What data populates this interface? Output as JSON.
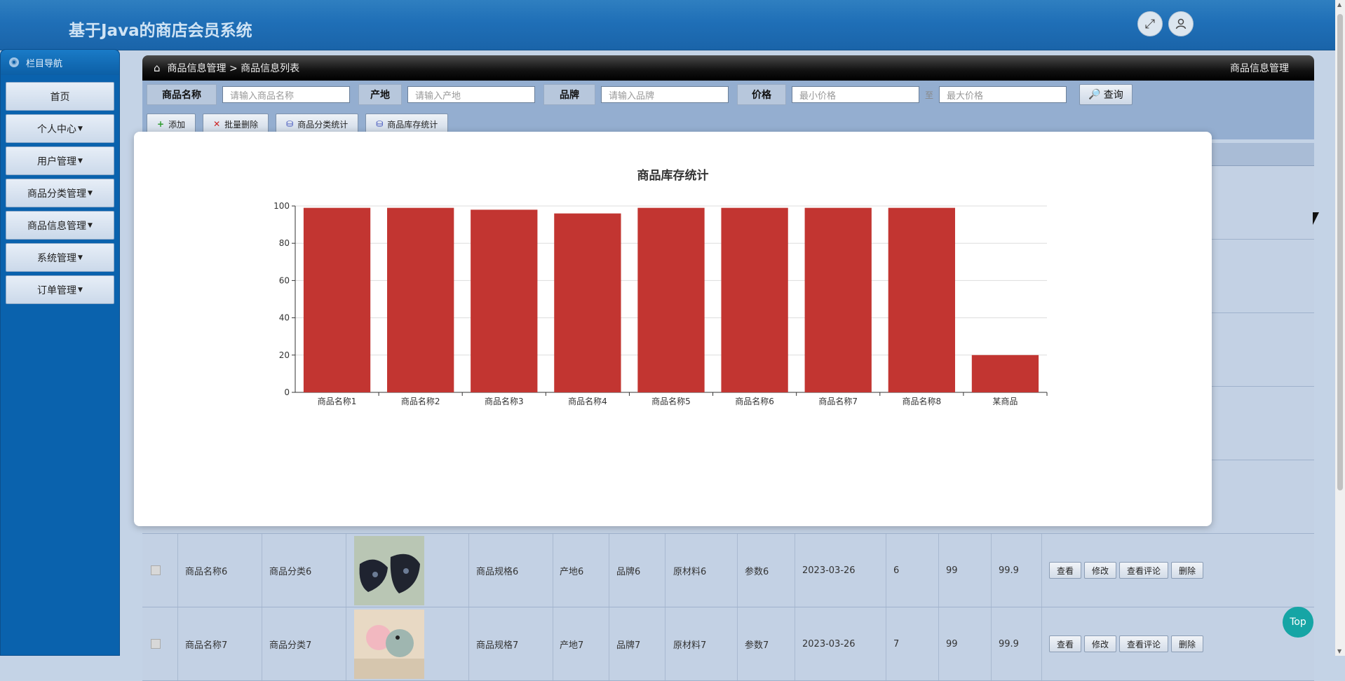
{
  "app": {
    "title": "基于Java的商店会员系统"
  },
  "header": {
    "fullscreen_icon": "expand-arrows-icon",
    "user_icon": "user-icon"
  },
  "sidebar": {
    "nav_title": "栏目导航",
    "items": [
      {
        "label": "首页",
        "has_caret": false
      },
      {
        "label": "个人中心",
        "has_caret": true
      },
      {
        "label": "用户管理",
        "has_caret": true
      },
      {
        "label": "商品分类管理",
        "has_caret": true
      },
      {
        "label": "商品信息管理",
        "has_caret": true
      },
      {
        "label": "系统管理",
        "has_caret": true
      },
      {
        "label": "订单管理",
        "has_caret": true
      }
    ]
  },
  "breadcrumb": {
    "path": "商品信息管理 > 商品信息列表",
    "right": "商品信息管理"
  },
  "search": {
    "name_label": "商品名称",
    "name_placeholder": "请输入商品名称",
    "origin_label": "产地",
    "origin_placeholder": "请输入产地",
    "brand_label": "品牌",
    "brand_placeholder": "请输入品牌",
    "price_label": "价格",
    "min_price_placeholder": "最小价格",
    "to": "至",
    "max_price_placeholder": "最大价格",
    "query_button": "查询"
  },
  "toolbar": {
    "add": "添加",
    "batch_delete": "批量删除",
    "category_stats": "商品分类统计",
    "stock_stats": "商品库存统计"
  },
  "table": {
    "rows": [
      {
        "name": "商品名称6",
        "category": "商品分类6",
        "spec": "商品规格6",
        "origin": "产地6",
        "brand": "品牌6",
        "material": "原材料6",
        "param": "参数6",
        "date": "2023-03-26",
        "num": "6",
        "stock": "99",
        "price": "99.9"
      },
      {
        "name": "商品名称7",
        "category": "商品分类7",
        "spec": "商品规格7",
        "origin": "产地7",
        "brand": "品牌7",
        "material": "原材料7",
        "param": "参数7",
        "date": "2023-03-26",
        "num": "7",
        "stock": "99",
        "price": "99.9"
      }
    ],
    "actions": {
      "view": "查看",
      "edit": "修改",
      "reviews": "查看评论",
      "delete": "删除"
    }
  },
  "modal": {
    "chart_title": "商品库存统计"
  },
  "chart_data": {
    "type": "bar",
    "title": "商品库存统计",
    "categories": [
      "商品名称1",
      "商品名称2",
      "商品名称3",
      "商品名称4",
      "商品名称5",
      "商品名称6",
      "商品名称7",
      "商品名称8",
      "某商品"
    ],
    "values": [
      99,
      99,
      98,
      96,
      99,
      99,
      99,
      99,
      20
    ],
    "ylim": [
      0,
      100
    ],
    "yticks": [
      0,
      20,
      40,
      60,
      80,
      100
    ],
    "grid": true,
    "bar_color": "#c23531"
  },
  "top_button": "Top",
  "colors": {
    "accent": "#1f6fb7",
    "sidebar": "#0a62ad",
    "bar": "#c23531",
    "top_button": "#16a5a5"
  }
}
